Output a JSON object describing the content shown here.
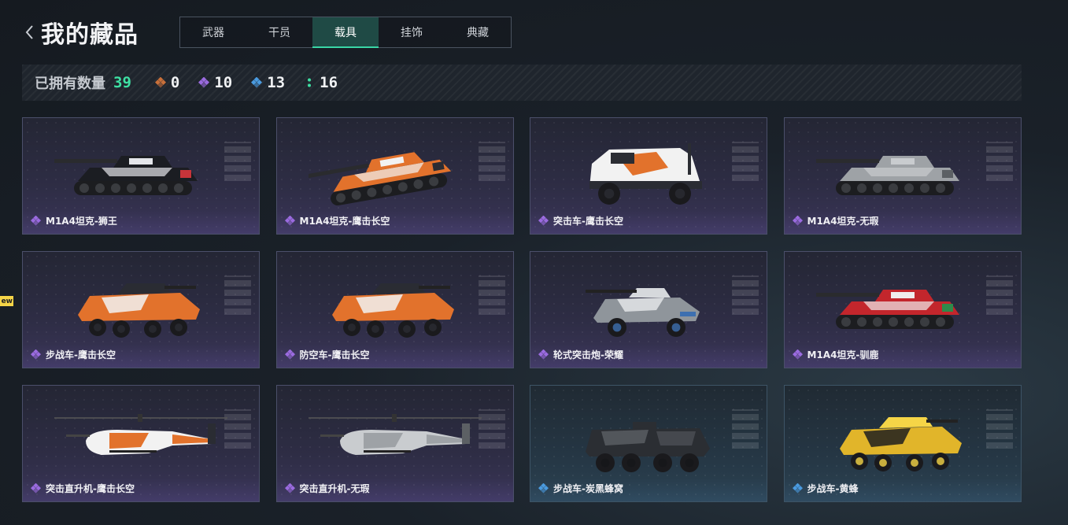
{
  "header": {
    "title": "我的藏品",
    "tabs": [
      {
        "label": "武器",
        "active": false
      },
      {
        "label": "干员",
        "active": false
      },
      {
        "label": "载具",
        "active": true
      },
      {
        "label": "挂饰",
        "active": false
      },
      {
        "label": "典藏",
        "active": false
      }
    ]
  },
  "stats": {
    "owned_label": "已拥有数量",
    "owned_count": "39",
    "rarities": [
      {
        "icon": "orange-rarity-diamond-icon",
        "color": "#c9703a",
        "count": "0"
      },
      {
        "icon": "purple-rarity-diamond-icon",
        "color": "#9b6be0",
        "count": "10"
      },
      {
        "icon": "blue-rarity-diamond-icon",
        "color": "#4a9be0",
        "count": "13"
      },
      {
        "icon": "green-rarity-dots-icon",
        "color": "#3ee0a3",
        "count": "16"
      }
    ]
  },
  "new_badge": "ew",
  "items": [
    {
      "name": "M1A4坦克-狮王",
      "rarity": "purple",
      "vehicle": "tank",
      "skin": "black-white"
    },
    {
      "name": "M1A4坦克-鹰击长空",
      "rarity": "purple",
      "vehicle": "tank-angled",
      "skin": "orange-camo"
    },
    {
      "name": "突击车-鹰击长空",
      "rarity": "purple",
      "vehicle": "assault-car",
      "skin": "orange-camo"
    },
    {
      "name": "M1A4坦克-无瑕",
      "rarity": "purple",
      "vehicle": "tank",
      "skin": "grey"
    },
    {
      "name": "步战车-鹰击长空",
      "rarity": "purple",
      "vehicle": "ifv",
      "skin": "orange-camo"
    },
    {
      "name": "防空车-鹰击长空",
      "rarity": "purple",
      "vehicle": "ifv",
      "skin": "orange-camo"
    },
    {
      "name": "轮式突击炮-荣耀",
      "rarity": "purple",
      "vehicle": "wheeled-gun",
      "skin": "grey-blue"
    },
    {
      "name": "M1A4坦克-驯鹿",
      "rarity": "purple",
      "vehicle": "tank",
      "skin": "red-reindeer"
    },
    {
      "name": "突击直升机-鹰击长空",
      "rarity": "purple",
      "vehicle": "helicopter",
      "skin": "orange-camo"
    },
    {
      "name": "突击直升机-无瑕",
      "rarity": "purple",
      "vehicle": "helicopter",
      "skin": "grey"
    },
    {
      "name": "步战车-炭黑蜂窝",
      "rarity": "blue",
      "vehicle": "apc",
      "skin": "black-hex"
    },
    {
      "name": "步战车-黄蜂",
      "rarity": "blue",
      "vehicle": "ifv",
      "skin": "yellow-wasp"
    }
  ]
}
